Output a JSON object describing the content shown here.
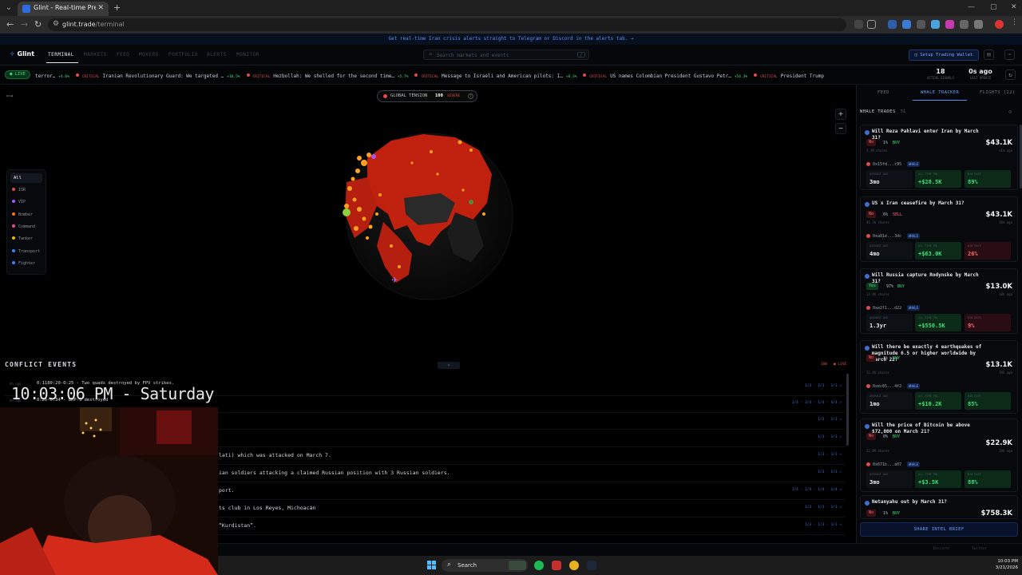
{
  "browser": {
    "tab_title": "Glint - Real-time Prediction Ma...",
    "url_host": "glint.trade",
    "url_path": "/terminal"
  },
  "banner": "Get real-time Iran crisis alerts straight to Telegram or Discord in the alerts tab. →",
  "app": {
    "logo": "Glint",
    "nav": [
      "TERMINAL",
      "MARKETS",
      "FEED",
      "MOVERS",
      "PORTFOLIO",
      "ALERTS",
      "MONITOR"
    ],
    "search_placeholder": "Search markets and events",
    "search_kbd": "/",
    "setup_wallet": "Setup Trading Wallet"
  },
  "ticker": {
    "live_label": "LIVE",
    "items": [
      {
        "tag": "",
        "text": "terror…",
        "change": "+4.6%"
      },
      {
        "tag": "CRITICAL",
        "text": "Iranian Revolutionary Guard: We targeted …",
        "change": "+10.5%"
      },
      {
        "tag": "CRITICAL",
        "text": "Hezbollah: We shelled for the second time…",
        "change": "+5.7%"
      },
      {
        "tag": "CRITICAL",
        "text": "Message to Israeli and American pilots: I…",
        "change": "+6.3%"
      },
      {
        "tag": "CRITICAL",
        "text": "US names Colombian President Gustavo Petr…",
        "change": "+54.3%"
      },
      {
        "tag": "CRITICAL",
        "text": "President Trump",
        "change": ""
      }
    ],
    "active_signals": "18",
    "active_signals_label": "ACTIVE SIGNALS",
    "last_update": "0s ago",
    "last_update_label": "LAST UPDATE"
  },
  "map": {
    "tension_label": "GLOBAL TENSION",
    "tension_value": "100",
    "tension_level": "SEVERE",
    "filters": [
      {
        "label": "All",
        "color": ""
      },
      {
        "label": "ISR",
        "color": "#e5484d"
      },
      {
        "label": "VIP",
        "color": "#a855f7"
      },
      {
        "label": "Bomber",
        "color": "#f97316"
      },
      {
        "label": "Command",
        "color": "#ec4899"
      },
      {
        "label": "Tanker",
        "color": "#eab308"
      },
      {
        "label": "Transport",
        "color": "#3b82f6"
      },
      {
        "label": "Fighter",
        "color": "#3b82f6"
      }
    ]
  },
  "events": {
    "title": "CONFLICT EVENTS",
    "count": "100",
    "live": "● LIVE",
    "collapse": "▴",
    "rows": [
      {
        "ago": "6h ago",
        "text": "0:1180:20-0:25 - Two quads destroyed by FPV strikes.",
        "meta": "1/3 · 2/3 · 1/3 ↗"
      },
      {
        "ago": "6h ago",
        "text": "0:26-0:34 - BMP-3 destroyed",
        "meta": "1/4 · 3/4 · 1/4 · 4/4 ↗"
      },
      {
        "ago": "",
        "text": "",
        "meta": "1/3 · 1/3 ↗"
      },
      {
        "ago": "",
        "text": "",
        "meta": "1/3 · 1/3 ↗"
      },
      {
        "ago": "",
        "text": "lati) which was attacked on March 7.",
        "meta": "1/3 · 1/3 ↗"
      },
      {
        "ago": "",
        "text": "ian soldiers attacking a claimed Russian position with 3 Russian soldiers.",
        "meta": "1/3 · 1/3 ↗"
      },
      {
        "ago": "",
        "text": "port.",
        "meta": "1/4 · 2/4 · 1/4 · 1/4 ↗"
      },
      {
        "ago": "",
        "text": "ts club in Los Reyes, Michoacán",
        "meta": "1/3 · 1/3 · 1/3 ↗"
      },
      {
        "ago": "",
        "text": "“Kurdistan”.",
        "meta": "1/3 · 1/3 · 1/3 ↗"
      }
    ]
  },
  "clock_overlay": "10:03:06 PM - Saturday",
  "panel": {
    "tabs": [
      "FEED",
      "WHALE TRACKER",
      "FLIGHTS (22)"
    ],
    "section": "WHALE TRADES",
    "section_count": "51",
    "cards": [
      {
        "question": "Will Reza Pahlavi enter Iran by March 31?",
        "side": "No",
        "side_type": "no",
        "price": "1%",
        "action": "BUY",
        "action_type": "buy",
        "shares": "4.3M shares",
        "amount": "$43.1K",
        "ago": "<1m ago",
        "wallet": "0x15fd...c95",
        "badge": "WHALE",
        "l1": "AVERAGE AGE",
        "v1": "3mo",
        "l2": "ALL-TIME PNL",
        "v2": "+$28.5K",
        "l3": "WIN RATE",
        "v3": "89%",
        "v3_type": "g"
      },
      {
        "question": "US x Iran ceasefire by March 31?",
        "side": "No",
        "side_type": "no",
        "price": "6%",
        "action": "SELL",
        "action_type": "sell",
        "shares": "46.7K shares",
        "amount": "$43.1K",
        "ago": "18m ago",
        "wallet": "0xa81e...3dc",
        "badge": "WHALE",
        "l1": "AVERAGE AGE",
        "v1": "4mo",
        "l2": "ALL-TIME PNL",
        "v2": "+$63.0K",
        "l3": "WIN RATE",
        "v3": "26%",
        "v3_type": "r"
      },
      {
        "question": "Will Russia capture Rodynske by March 31?",
        "side": "Yes",
        "side_type": "yes",
        "price": "97%",
        "action": "BUY",
        "action_type": "buy",
        "shares": "13.4K shares",
        "amount": "$13.0K",
        "ago": "18h ago",
        "wallet": "0xe2f1...d22",
        "badge": "WHALE",
        "l1": "AVERAGE AGE",
        "v1": "1.3yr",
        "l2": "ALL-TIME PNL",
        "v2": "+$550.5K",
        "l3": "WIN RATE",
        "v3": "9%",
        "v3_type": "r"
      },
      {
        "question": "Will there be exactly 4 earthquakes of magnitude 6.5 or higher worldwide by March 22?",
        "side": "No",
        "side_type": "no",
        "price": "2%",
        "action": "BUY",
        "action_type": "buy",
        "shares": "11.4K shares",
        "amount": "$13.1K",
        "ago": "19h ago",
        "wallet": "0xec65...4f2",
        "badge": "WHALE",
        "l1": "AVERAGE AGE",
        "v1": "1mo",
        "l2": "ALL-TIME PNL",
        "v2": "+$10.2K",
        "l3": "WIN RATE",
        "v3": "85%",
        "v3_type": "g"
      },
      {
        "question": "Will the price of Bitcoin be above $72,000 on March 21?",
        "side": "No",
        "side_type": "no",
        "price": "0%",
        "action": "BUY",
        "action_type": "buy",
        "shares": "22.9M shares",
        "amount": "$22.9K",
        "ago": "20h ago",
        "wallet": "0x671b...a07",
        "badge": "WHALE",
        "l1": "AVERAGE AGE",
        "v1": "3mo",
        "l2": "ALL-TIME PNL",
        "v2": "+$3.5K",
        "l3": "WIN RATE",
        "v3": "88%",
        "v3_type": "g"
      },
      {
        "question": "Netanyahu out by March 31?",
        "side": "No",
        "side_type": "no",
        "price": "1%",
        "action": "BUY",
        "action_type": "buy",
        "shares": "",
        "amount": "$758.3K",
        "ago": "",
        "wallet": "",
        "badge": "",
        "l1": "",
        "v1": "",
        "l2": "",
        "v2": "",
        "l3": "",
        "v3": "",
        "v3_type": "g"
      }
    ],
    "share_button": "SHARE INTEL BRIEF"
  },
  "footer": [
    "Discord",
    "Twitter"
  ],
  "taskbar": {
    "search_label": "Search",
    "time": "10:03 PM",
    "date": "3/21/2026"
  }
}
